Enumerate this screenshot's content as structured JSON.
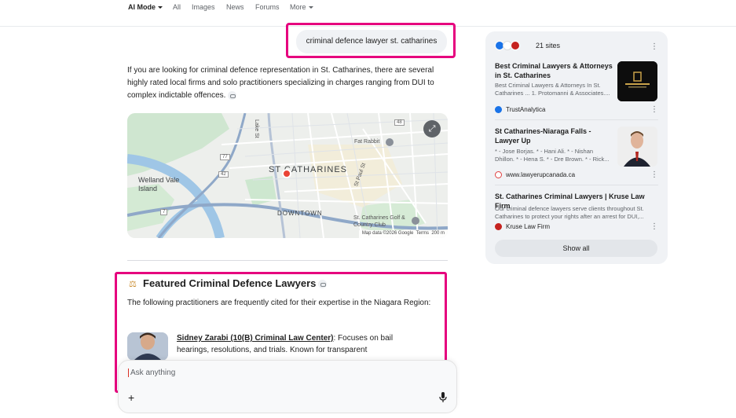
{
  "nav": {
    "ai_mode": "AI Mode",
    "all": "All",
    "images": "Images",
    "news": "News",
    "forums": "Forums",
    "more": "More"
  },
  "query": "criminal defence lawyer st. catharines",
  "intro": "If you are looking for criminal defence representation in St. Catharines, there are several highly rated local firms and solo practitioners specializing in charges ranging from DUI to complex indictable offences.",
  "map": {
    "city": "ST CATHARINES",
    "downtown": "DOWNTOWN",
    "island": "Welland Vale Island",
    "lake_st": "Lake St",
    "st_paul": "St Paul St",
    "poi_fat_rabbit": "Fat Rabbit",
    "poi_golf": "St. Catharines Golf & Country Club",
    "shields": [
      "77",
      "42",
      "48",
      "7"
    ],
    "attribution": "Map data ©2026 Google",
    "terms": "Terms",
    "scale": "200 m"
  },
  "featured": {
    "title": "Featured Criminal Defence Lawyers",
    "desc": "The following practitioners are frequently cited for their expertise in the Niagara Region:",
    "lawyer_name": "Sidney Zarabi (10(B) Criminal Law Center)",
    "lawyer_text": ": Focuses on bail hearings, resolutions, and trials. Known for transparent"
  },
  "ask": {
    "placeholder": "Ask anything"
  },
  "panel": {
    "sites": "21 sites",
    "show_all": "Show all",
    "cards": [
      {
        "title": "Best Criminal Lawyers & Attorneys in St. Catharines",
        "snippet": "Best Criminal Lawyers & Attorneys In St. Catharines ... 1. Protomanni & Associates....",
        "source": "TrustAnalytica"
      },
      {
        "title": "St Catharines-Niaraga Falls - Lawyer Up",
        "snippet": "* - Jose Borjas. * - Hani Ali. * - Nishan Dhillon. * - Hena S. * - Dre Brown. * - Rick...",
        "source": "www.lawyerupcanada.ca"
      },
      {
        "title": "St. Catharines Criminal Lawyers | Kruse Law Firm",
        "snippet": "Our criminal defence lawyers serve clients throughout St. Catharines to protect your rights after an arrest for DUI,...",
        "source": "Kruse Law Firm"
      }
    ]
  }
}
